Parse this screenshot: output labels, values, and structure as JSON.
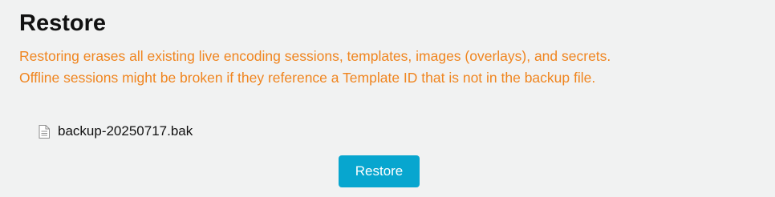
{
  "title": "Restore",
  "warning": {
    "line1": "Restoring erases all existing live encoding sessions, templates, images (overlays), and secrets.",
    "line2": "Offline sessions might be broken if they reference a Template ID that is not in the backup file."
  },
  "file": {
    "icon": "file-icon",
    "name": "backup-20250717.bak"
  },
  "restore_button": {
    "label": "Restore"
  },
  "colors": {
    "background": "#f1f2f2",
    "warning_text": "#f0851f",
    "button_bg": "#07a6cf",
    "button_text": "#ffffff"
  }
}
